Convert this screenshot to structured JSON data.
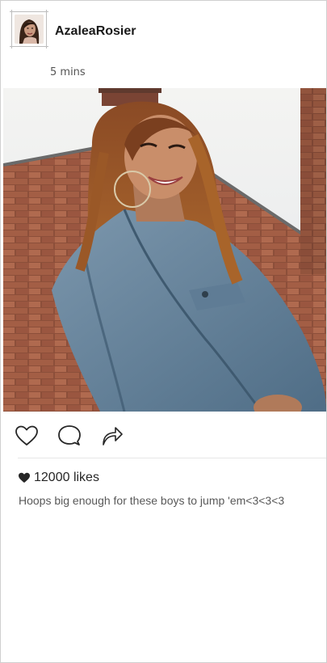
{
  "post": {
    "username": "AzaleaRosier",
    "time": "5 mins",
    "likes_text": "12000 likes",
    "caption": "Hoops big enough for these boys to jump 'em<3<3<3"
  },
  "actions": {
    "like_icon": "heart-icon",
    "comment_icon": "comment-icon",
    "share_icon": "share-arrow-icon"
  },
  "colors": {
    "border": "#cfcfcf",
    "text_primary": "#1a1a1a",
    "text_secondary": "#595959"
  }
}
